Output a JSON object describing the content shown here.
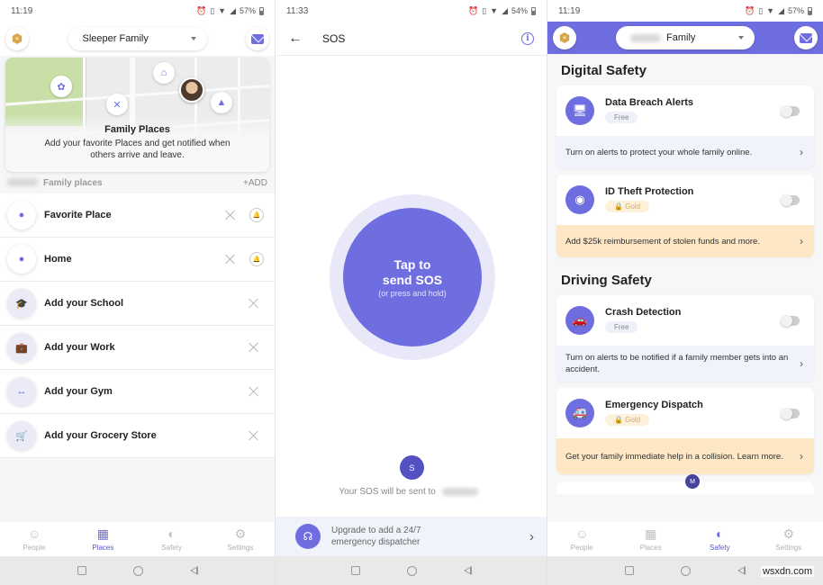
{
  "screens": {
    "places": {
      "status": {
        "time": "11:19",
        "battery": "57%"
      },
      "header": {
        "family_name": "Sleeper Family"
      },
      "map_card": {
        "title": "Family Places",
        "text": "Add your favorite Places and get notified when others arrive and leave."
      },
      "section": {
        "label": "Family places",
        "add_label": "+ADD"
      },
      "places": [
        {
          "label": "Favorite Place",
          "icon": "map-pin-icon",
          "glyph": "●",
          "tinted": false,
          "has_bell": true
        },
        {
          "label": "Home",
          "icon": "map-pin-icon",
          "glyph": "●",
          "tinted": false,
          "has_bell": true
        },
        {
          "label": "Add your School",
          "icon": "graduation-cap-icon",
          "glyph": "🎓",
          "tinted": true,
          "has_bell": false
        },
        {
          "label": "Add your Work",
          "icon": "briefcase-icon",
          "glyph": "💼",
          "tinted": true,
          "has_bell": false
        },
        {
          "label": "Add your Gym",
          "icon": "dumbbell-icon",
          "glyph": "↔",
          "tinted": true,
          "has_bell": false
        },
        {
          "label": "Add your Grocery Store",
          "icon": "cart-icon",
          "glyph": "🛒",
          "tinted": true,
          "has_bell": false
        }
      ],
      "active_tab": "Places"
    },
    "sos": {
      "status": {
        "time": "11:33",
        "battery": "54%"
      },
      "title": "SOS",
      "button_main": "Tap to send SOS",
      "button_line1": "Tap to",
      "button_line2": "send SOS",
      "button_sub": "(or press and hold)",
      "recipient_initial": "S",
      "sent_to_text": "Your SOS will be sent to",
      "upgrade_text_1": "Upgrade to add a 24/7",
      "upgrade_text_2": "emergency dispatcher"
    },
    "safety": {
      "status": {
        "time": "11:19",
        "battery": "57%"
      },
      "header": {
        "family_name": "Family"
      },
      "sections": [
        {
          "title": "Digital Safety",
          "cards": [
            {
              "title": "Data Breach Alerts",
              "tier": "Free",
              "tier_type": "free",
              "icon": "monitor-icon",
              "glyph": "🖥",
              "enabled": false,
              "footer": "Turn on alerts to protect your whole family online.",
              "footer_style": "blue"
            },
            {
              "title": "ID Theft Protection",
              "tier": "🔒 Gold",
              "tier_type": "gold",
              "icon": "fingerprint-icon",
              "glyph": "◉",
              "enabled": false,
              "footer": "Add $25k reimbursement of stolen funds and more.",
              "footer_style": "gold"
            }
          ]
        },
        {
          "title": "Driving Safety",
          "cards": [
            {
              "title": "Crash Detection",
              "tier": "Free",
              "tier_type": "free",
              "icon": "car-crash-icon",
              "glyph": "🚗",
              "enabled": false,
              "footer": "Turn on alerts to be notified if a family member gets into an accident.",
              "footer_style": "blue"
            },
            {
              "title": "Emergency Dispatch",
              "tier": "🔒 Gold",
              "tier_type": "gold",
              "icon": "ambulance-icon",
              "glyph": "🚑",
              "enabled": false,
              "footer": "Get your family immediate help in a collision. Learn more.",
              "footer_style": "gold"
            }
          ]
        }
      ],
      "peek_avatar_initial": "M",
      "active_tab": "Safety"
    }
  },
  "bottom_nav": [
    {
      "label": "People",
      "icon": "person-icon",
      "glyph": "☺"
    },
    {
      "label": "Places",
      "icon": "buildings-icon",
      "glyph": "▦"
    },
    {
      "label": "Safety",
      "icon": "shield-icon",
      "glyph": "◐"
    },
    {
      "label": "Settings",
      "icon": "gear-icon",
      "glyph": "⚙"
    }
  ],
  "watermark": "wsxdn.com",
  "colors": {
    "accent": "#6f6ee0",
    "gold": "#d4aa5c",
    "gold_bg": "#fde7c5",
    "info_bg": "#f0f3fb"
  }
}
